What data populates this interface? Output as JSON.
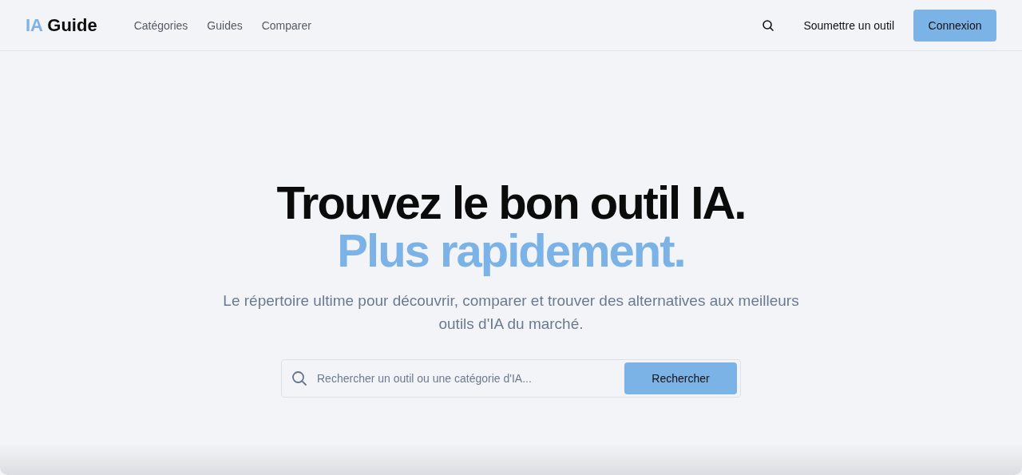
{
  "header": {
    "logo": {
      "accent": "IA",
      "text": "Guide"
    },
    "nav": [
      {
        "label": "Catégories"
      },
      {
        "label": "Guides"
      },
      {
        "label": "Comparer"
      }
    ],
    "submit_link": "Soumettre un outil",
    "login_button": "Connexion"
  },
  "hero": {
    "title": "Trouvez le bon outil IA.",
    "title_accent": "Plus rapidement.",
    "subtitle": "Le répertoire ultime pour découvrir, comparer et trouver des alternatives aux meilleurs outils d'IA du marché.",
    "search": {
      "placeholder": "Rechercher un outil ou une catégorie d'IA...",
      "button": "Rechercher"
    }
  }
}
